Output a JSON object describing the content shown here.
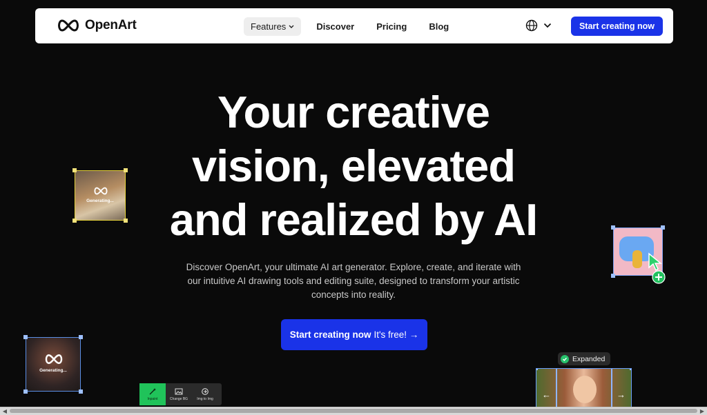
{
  "brand": {
    "name": "OpenArt"
  },
  "nav": {
    "items": [
      {
        "label": "Features",
        "has_dropdown": true
      },
      {
        "label": "Discover"
      },
      {
        "label": "Pricing"
      },
      {
        "label": "Blog"
      }
    ],
    "cta_label": "Start creating now"
  },
  "hero": {
    "title_line1": "Your creative",
    "title_line2": "vision, elevated",
    "title_line3": "and realized by AI",
    "subtitle": "Discover OpenArt, your ultimate AI art generator. Explore, create, and iterate with our intuitive AI drawing tools and editing suite, designed to transform your artistic concepts into reality.",
    "cta_label": "Start creating now",
    "cta_suffix": "It's free! →"
  },
  "decor": {
    "generating_label_1": "Generating...",
    "generating_label_2": "Generating...",
    "expanded_label": "Expanded",
    "tools": [
      {
        "label": "Inpaint",
        "active": true
      },
      {
        "label": "Change BG",
        "active": false
      },
      {
        "label": "Img to Img",
        "active": false
      }
    ]
  },
  "colors": {
    "accent": "#1a33e8",
    "background": "#0a0a0a",
    "success": "#27c26c"
  }
}
